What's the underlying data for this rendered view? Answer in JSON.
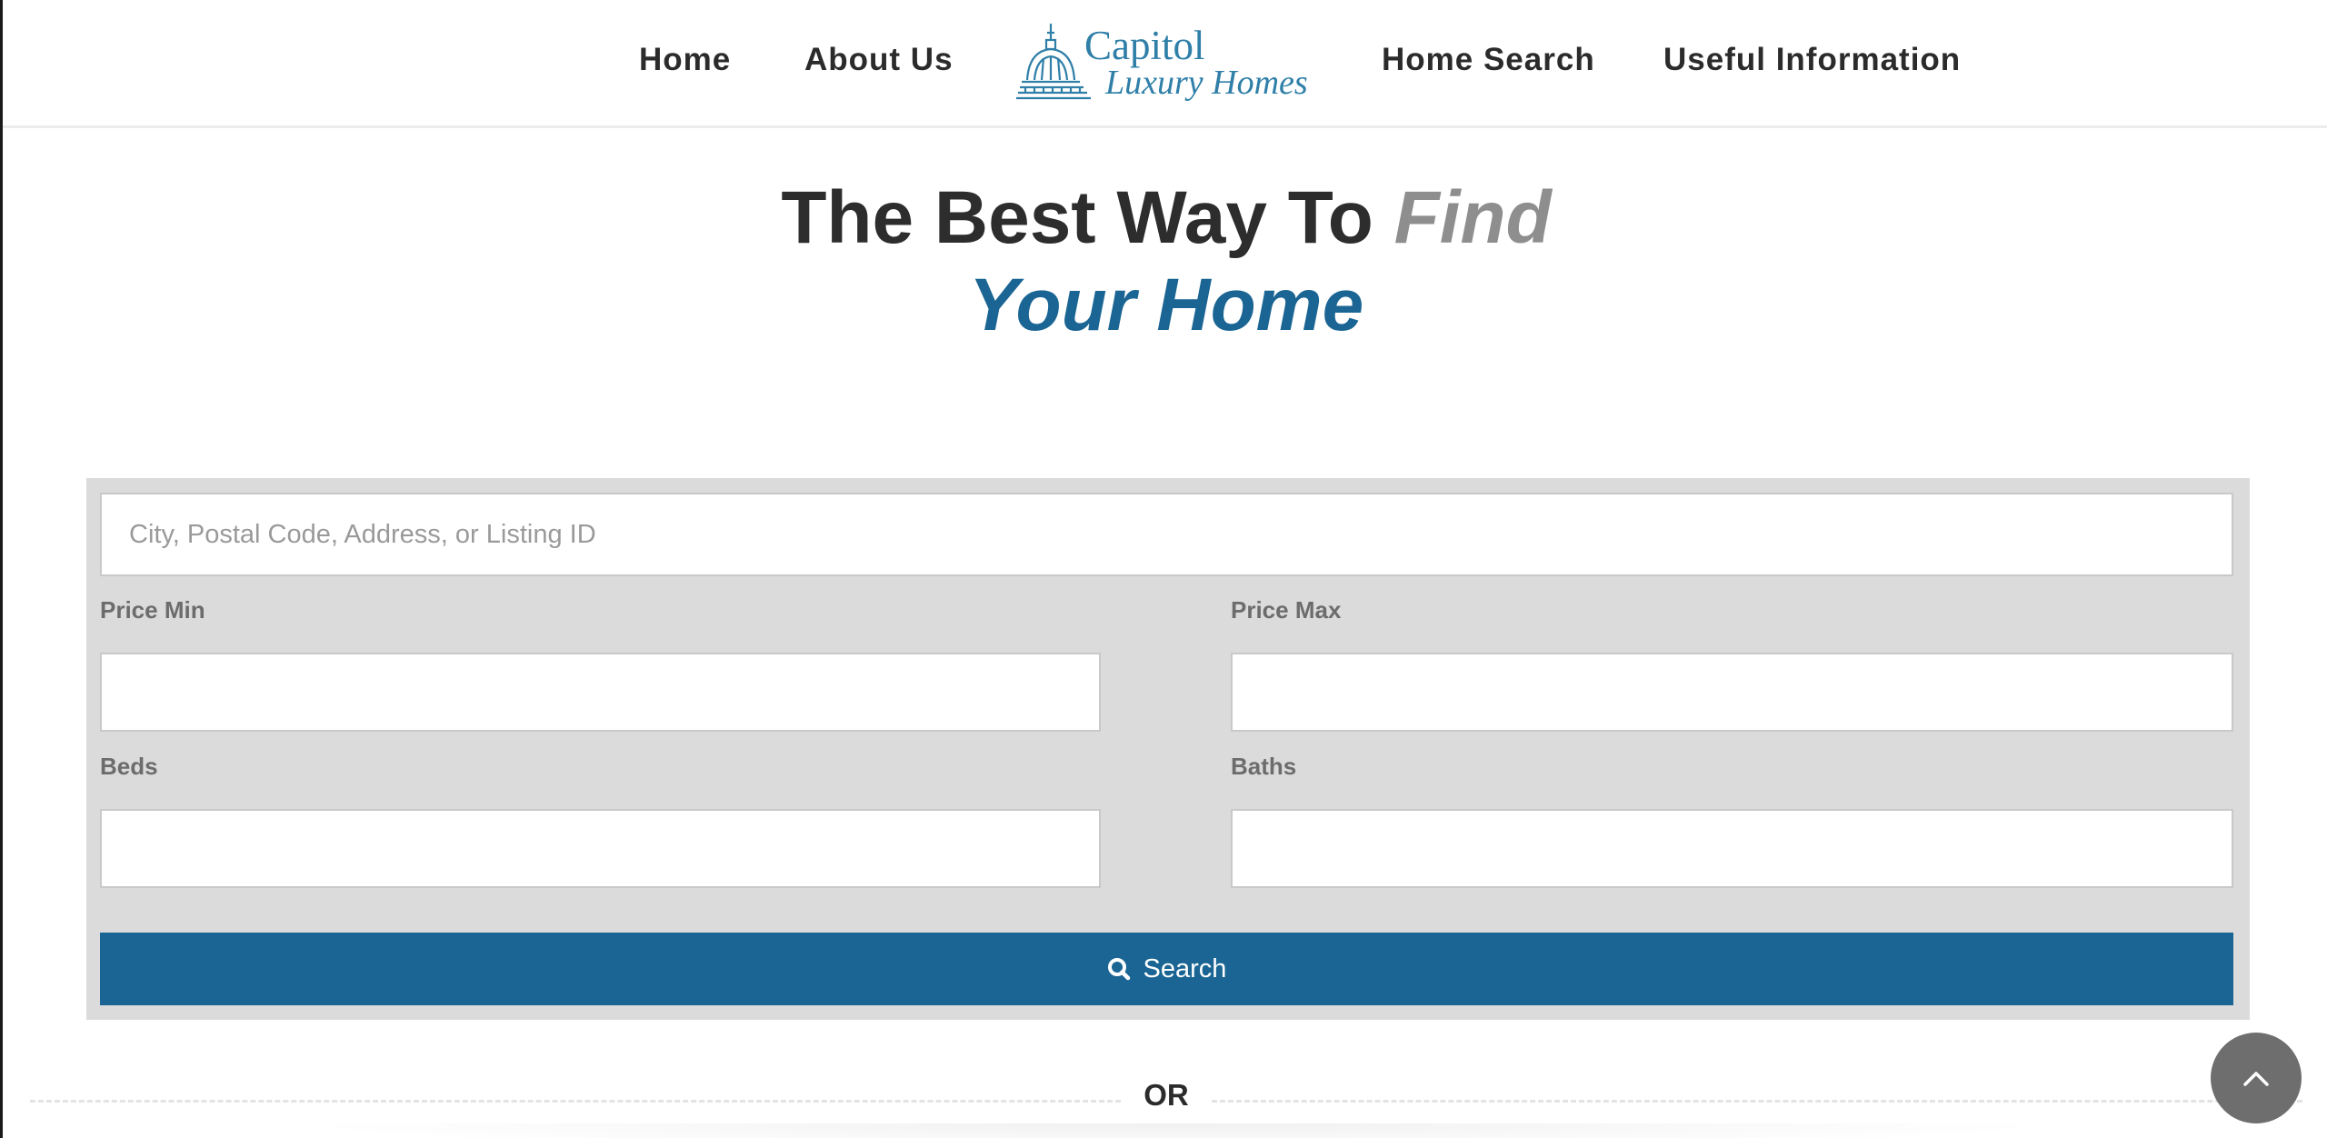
{
  "nav": {
    "items": [
      "Home",
      "About Us",
      "Home Search",
      "Useful Information"
    ]
  },
  "logo": {
    "line1": "Capitol",
    "line2": "Luxury Homes",
    "icon": "capitol-dome-icon",
    "color": "#2f7fa8"
  },
  "hero": {
    "part1": "The Best Way To ",
    "part2": "Find",
    "part3": "Your Home"
  },
  "search": {
    "location_placeholder": "City, Postal Code, Address, or Listing ID",
    "location_value": "",
    "price_min_label": "Price Min",
    "price_min_value": "",
    "price_max_label": "Price Max",
    "price_max_value": "",
    "beds_label": "Beds",
    "beds_value": "",
    "baths_label": "Baths",
    "baths_value": "",
    "button_label": "Search",
    "button_icon": "search-icon"
  },
  "divider": {
    "label": "OR"
  },
  "back_to_top": {
    "icon": "chevron-up-icon"
  },
  "colors": {
    "primary": "#1a6593",
    "panel_bg": "#dbdbdb",
    "muted_text": "#8e8e8e",
    "heading_text": "#2d2d2d"
  }
}
